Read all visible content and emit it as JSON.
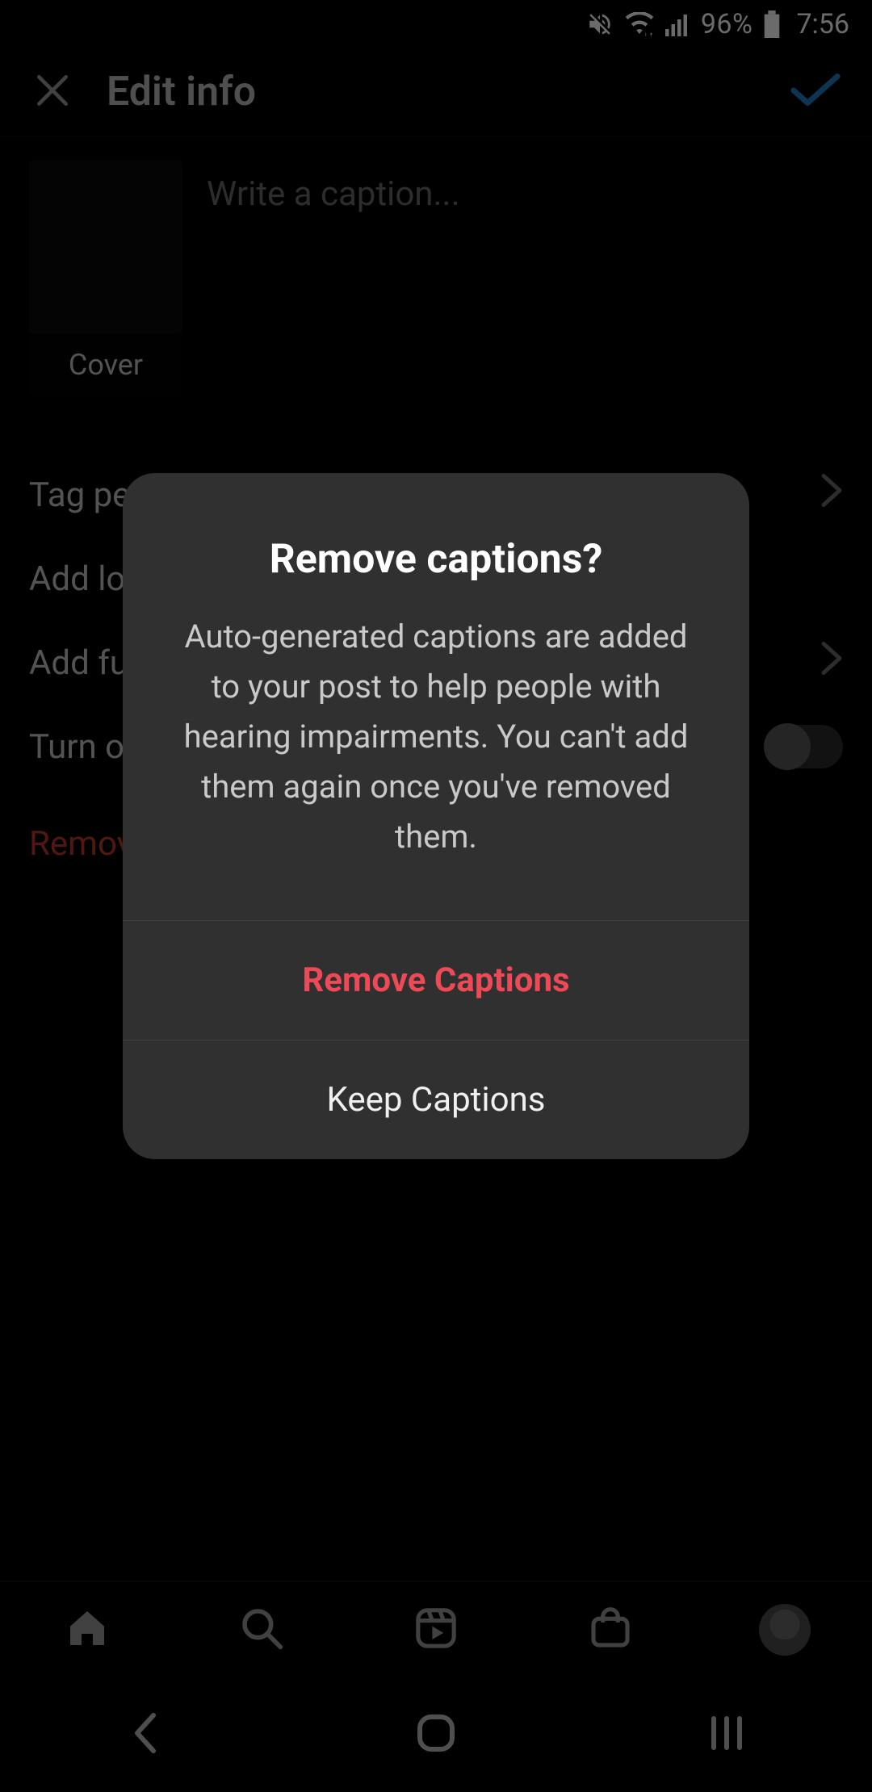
{
  "status": {
    "battery_percent": "96%",
    "time": "7:56"
  },
  "header": {
    "title": "Edit info"
  },
  "editor": {
    "caption_placeholder": "Write a caption...",
    "cover_label": "Cover"
  },
  "rows": {
    "tag_people": "Tag people",
    "add_location": "Add location",
    "add_fundraiser": "Add fundraiser",
    "turn_off_commenting": "Turn off commenting",
    "remove_captions": "Remove auto-generated captions"
  },
  "dialog": {
    "title": "Remove captions?",
    "body": "Auto-generated captions are added to your post to help people with hearing impairments. You can't add them again once you've removed them.",
    "primary": "Remove Captions",
    "secondary": "Keep Captions"
  }
}
